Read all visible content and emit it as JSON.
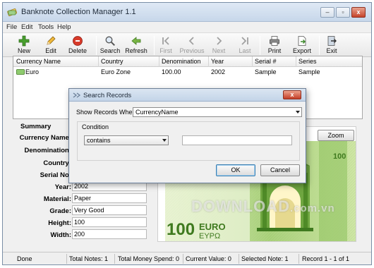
{
  "window": {
    "title": "Banknote Collection Manager 1.1"
  },
  "menu": [
    "File",
    "Edit",
    "Tools",
    "Help"
  ],
  "toolbar": [
    {
      "label": "New",
      "icon": "plus-icon"
    },
    {
      "label": "Edit",
      "icon": "pencil-icon"
    },
    {
      "label": "Delete",
      "icon": "delete-icon"
    },
    {
      "label": "Search",
      "icon": "search-icon"
    },
    {
      "label": "Refresh",
      "icon": "refresh-icon"
    },
    {
      "label": "First",
      "icon": "first-icon",
      "disabled": true
    },
    {
      "label": "Previous",
      "icon": "previous-icon",
      "disabled": true
    },
    {
      "label": "Next",
      "icon": "next-icon",
      "disabled": true
    },
    {
      "label": "Last",
      "icon": "last-icon",
      "disabled": true
    },
    {
      "label": "Print",
      "icon": "print-icon"
    },
    {
      "label": "Export",
      "icon": "export-icon"
    },
    {
      "label": "Exit",
      "icon": "exit-icon"
    }
  ],
  "grid": {
    "columns": [
      "Currency Name",
      "Country",
      "Denomination",
      "Year",
      "Serial #",
      "Series"
    ],
    "rows": [
      [
        "Euro",
        "Euro Zone",
        "100.00",
        "2002",
        "Sample",
        "Sample"
      ]
    ]
  },
  "summary": {
    "title": "Summary",
    "fields": [
      {
        "label": "Currency Name:",
        "value": ""
      },
      {
        "label": "Denomination:",
        "value": ""
      },
      {
        "label": "Country:",
        "value": ""
      },
      {
        "label": "Serial No:",
        "value": ""
      },
      {
        "label": "Year:",
        "value": "2002"
      },
      {
        "label": "Material:",
        "value": "Paper"
      },
      {
        "label": "Grade:",
        "value": "Very Good"
      },
      {
        "label": "Height:",
        "value": "100"
      },
      {
        "label": "Width:",
        "value": "200"
      }
    ]
  },
  "preview": {
    "zoom_label": "Zoom",
    "note_value": "100",
    "note_currency": "EURO",
    "note_currency_greek": "EYPΩ",
    "watermark": "DOWNLOAD",
    "watermark_suffix": ".com.vn"
  },
  "status": [
    "Done",
    "Total Notes: 1",
    "Total Money Spend: 0",
    "Current Value: 0",
    "Selected Note: 1",
    "Record 1 - 1 of 1"
  ],
  "dialog": {
    "title": "Search Records",
    "show_label": "Show Records Where?",
    "field_value": "CurrencyName",
    "condition_label": "Condition",
    "condition_value": "contains",
    "search_text": "",
    "ok_label": "OK",
    "cancel_label": "Cancel"
  },
  "colors": {
    "title_bar": "#c7d7ea",
    "close_button": "#c5432b",
    "note_green": "#7fb64e"
  }
}
